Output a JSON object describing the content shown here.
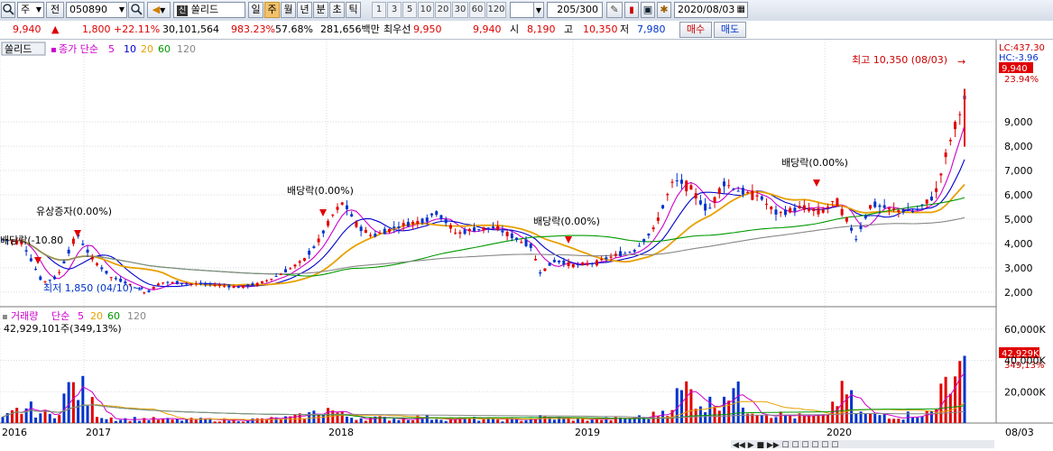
{
  "toolbar": {
    "market": "주",
    "prev_label": "전",
    "code": "050890",
    "stock_name": "쏠리드",
    "periods": [
      "일",
      "주",
      "월",
      "년",
      "분",
      "초",
      "틱"
    ],
    "selected_period": "주",
    "intervals": [
      "1",
      "3",
      "5",
      "10",
      "20",
      "30",
      "60",
      "120"
    ],
    "count": "205",
    "count_total": "/300",
    "date": "2020/08/03"
  },
  "quote": {
    "price": "9,940",
    "change": "1,800",
    "change_pct": "+22.11%",
    "volume": "30,101,564",
    "volume_ratio": "983.23%",
    "turnover": "57.68%",
    "amount": "281,656백만",
    "best_bid_label": "최우선",
    "best_ask": "9,950",
    "best_bid": "9,940",
    "open_label": "시",
    "open": "8,190",
    "high_label": "고",
    "high": "10,350",
    "low_label": "저",
    "low": "7,980",
    "buy_label": "매수",
    "sell_label": "매도"
  },
  "price_panel": {
    "tab": "쏠리드",
    "legend_prefix": "종가 단순",
    "ma_periods": [
      "5",
      "10",
      "20",
      "60",
      "120"
    ],
    "ma_colors": [
      "#cc00cc",
      "#0000cc",
      "#e8a000",
      "#009900",
      "#888888"
    ],
    "lc_label": "LC:437.30",
    "hc_label": "HC:-3.96",
    "current_price": "9,940",
    "current_pct": "23.94%",
    "annotations": {
      "high": "최고 10,350 (08/03)",
      "low": "최저 1,850 (04/10)",
      "rights": "유상증자(0.00%)",
      "dividend1": "배당락(0.00%)",
      "dividend2": "배당락(0.00%)",
      "dividend3": "배당락(0.00%)",
      "cut": "배당락(-10.80"
    },
    "y_ticks": [
      "2,000",
      "3,000",
      "4,000",
      "5,000",
      "6,000",
      "7,000",
      "8,000",
      "9,000"
    ]
  },
  "volume_panel": {
    "legend_title": "거래량",
    "legend_prefix": "단순",
    "ma_periods": [
      "5",
      "20",
      "60",
      "120"
    ],
    "ma_colors": [
      "#cc00cc",
      "#e8a000",
      "#009900",
      "#888888"
    ],
    "value_text": "42,929,101주(349,13%)",
    "current": "42,929K",
    "current_pct": "349,13%",
    "y_ticks": [
      "20,000K",
      "40,000K",
      "60,000K"
    ]
  },
  "x_axis": {
    "labels": [
      "2016",
      "2017",
      "2018",
      "2019",
      "2020"
    ],
    "last_date": "08/03"
  },
  "chart_data": {
    "type": "candlestick",
    "price_min": 1850,
    "price_max": 10350,
    "low_date": "04/10",
    "high_date": "08/03",
    "ma_periods": [
      "5",
      "10",
      "20",
      "60",
      "120"
    ],
    "price_ticks": [
      2000,
      3000,
      4000,
      5000,
      6000,
      7000,
      8000,
      9000
    ],
    "volume_ticks": [
      20000,
      40000,
      60000
    ],
    "volume_unit": "K",
    "close_path": [
      [
        0,
        4150
      ],
      [
        0.02,
        4050
      ],
      [
        0.04,
        2400
      ],
      [
        0.055,
        2600
      ],
      [
        0.075,
        4400
      ],
      [
        0.09,
        3400
      ],
      [
        0.11,
        2600
      ],
      [
        0.125,
        2400
      ],
      [
        0.145,
        1950
      ],
      [
        0.16,
        2400
      ],
      [
        0.19,
        2350
      ],
      [
        0.215,
        2300
      ],
      [
        0.24,
        2200
      ],
      [
        0.26,
        2350
      ],
      [
        0.28,
        2700
      ],
      [
        0.305,
        3300
      ],
      [
        0.32,
        4100
      ],
      [
        0.335,
        5200
      ],
      [
        0.345,
        5700
      ],
      [
        0.36,
        4700
      ],
      [
        0.375,
        4300
      ],
      [
        0.4,
        4700
      ],
      [
        0.43,
        5000
      ],
      [
        0.44,
        5300
      ],
      [
        0.46,
        4400
      ],
      [
        0.48,
        4600
      ],
      [
        0.5,
        4650
      ],
      [
        0.52,
        4200
      ],
      [
        0.535,
        3900
      ],
      [
        0.545,
        2800
      ],
      [
        0.56,
        3300
      ],
      [
        0.58,
        3100
      ],
      [
        0.6,
        3200
      ],
      [
        0.62,
        3500
      ],
      [
        0.64,
        3700
      ],
      [
        0.66,
        4600
      ],
      [
        0.68,
        6600
      ],
      [
        0.695,
        6400
      ],
      [
        0.715,
        5300
      ],
      [
        0.73,
        6500
      ],
      [
        0.75,
        6100
      ],
      [
        0.765,
        6000
      ],
      [
        0.785,
        5200
      ],
      [
        0.81,
        5500
      ],
      [
        0.83,
        5300
      ],
      [
        0.845,
        5800
      ],
      [
        0.865,
        4200
      ],
      [
        0.88,
        5600
      ],
      [
        0.9,
        5400
      ],
      [
        0.925,
        5300
      ],
      [
        0.945,
        6000
      ],
      [
        0.96,
        8200
      ],
      [
        0.975,
        9940
      ]
    ],
    "volume_bars": [
      [
        0.0,
        3500
      ],
      [
        0.013,
        9000
      ],
      [
        0.026,
        12000
      ],
      [
        0.039,
        8000
      ],
      [
        0.052,
        5500
      ],
      [
        0.063,
        22000
      ],
      [
        0.075,
        30000
      ],
      [
        0.083,
        24000
      ],
      [
        0.091,
        15000
      ],
      [
        0.1,
        6000
      ],
      [
        0.11,
        4500
      ],
      [
        0.12,
        3000
      ],
      [
        0.14,
        3500
      ],
      [
        0.16,
        3000
      ],
      [
        0.18,
        2500
      ],
      [
        0.2,
        2800
      ],
      [
        0.22,
        2600
      ],
      [
        0.24,
        2400
      ],
      [
        0.26,
        2900
      ],
      [
        0.28,
        3500
      ],
      [
        0.3,
        4500
      ],
      [
        0.31,
        6000
      ],
      [
        0.32,
        8000
      ],
      [
        0.33,
        12000
      ],
      [
        0.34,
        9000
      ],
      [
        0.35,
        5500
      ],
      [
        0.37,
        4000
      ],
      [
        0.4,
        3600
      ],
      [
        0.43,
        4500
      ],
      [
        0.46,
        3500
      ],
      [
        0.49,
        3200
      ],
      [
        0.51,
        2800
      ],
      [
        0.53,
        2600
      ],
      [
        0.55,
        4500
      ],
      [
        0.57,
        3500
      ],
      [
        0.6,
        3000
      ],
      [
        0.63,
        3200
      ],
      [
        0.66,
        5000
      ],
      [
        0.67,
        7000
      ],
      [
        0.68,
        12000
      ],
      [
        0.69,
        20000
      ],
      [
        0.7,
        27000
      ],
      [
        0.71,
        22000
      ],
      [
        0.72,
        13000
      ],
      [
        0.73,
        18000
      ],
      [
        0.745,
        31000
      ],
      [
        0.76,
        14000
      ],
      [
        0.78,
        9000
      ],
      [
        0.8,
        6000
      ],
      [
        0.82,
        5000
      ],
      [
        0.84,
        4500
      ],
      [
        0.855,
        20000
      ],
      [
        0.865,
        24000
      ],
      [
        0.875,
        8000
      ],
      [
        0.89,
        6000
      ],
      [
        0.905,
        7000
      ],
      [
        0.92,
        5000
      ],
      [
        0.935,
        8000
      ],
      [
        0.95,
        7500
      ],
      [
        0.958,
        12000
      ],
      [
        0.966,
        65000
      ],
      [
        0.972,
        27000
      ],
      [
        0.978,
        29000
      ],
      [
        0.985,
        42929
      ]
    ]
  }
}
